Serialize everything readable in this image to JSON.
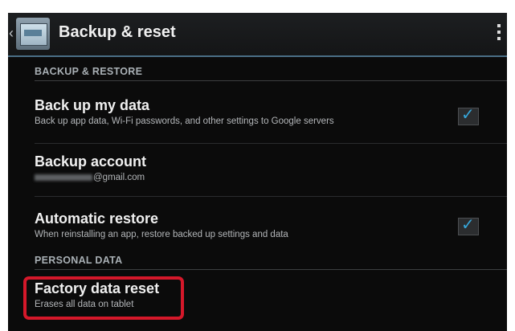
{
  "action_bar": {
    "title": "Backup & reset",
    "back_icon": "chevron-left-icon",
    "app_icon": "backup-reset-icon",
    "overflow_icon": "overflow-menu-icon"
  },
  "sections": {
    "backup_restore": {
      "header": "BACKUP & RESTORE",
      "back_up_my_data": {
        "title": "Back up my data",
        "summary": "Back up app data, Wi-Fi passwords, and other settings to Google servers",
        "checked": true
      },
      "backup_account": {
        "title": "Backup account",
        "summary_suffix": "@gmail.com"
      },
      "automatic_restore": {
        "title": "Automatic restore",
        "summary": "When reinstalling an app, restore backed up settings and data",
        "checked": true
      }
    },
    "personal_data": {
      "header": "PERSONAL DATA",
      "factory_data_reset": {
        "title": "Factory data reset",
        "summary": "Erases all data on tablet"
      }
    }
  },
  "colors": {
    "accent": "#36a6d9",
    "highlight": "#d5182a"
  }
}
